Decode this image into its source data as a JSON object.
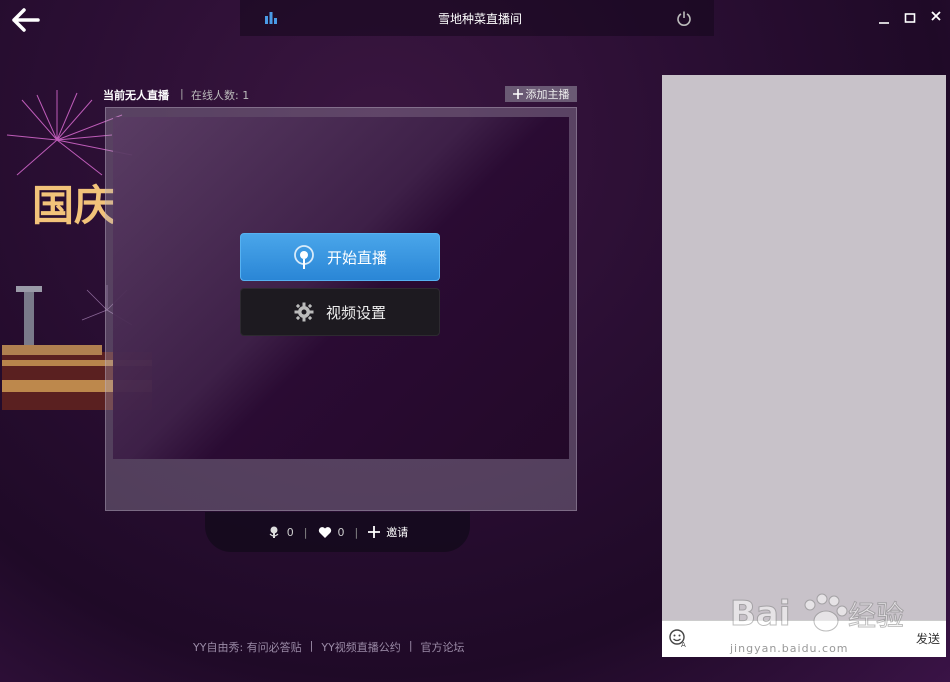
{
  "window": {
    "title": "雪地种菜直播间"
  },
  "live": {
    "status": "当前无人直播",
    "separator": "|",
    "online_text": "在线人数: 1",
    "add_host_label": "添加主播"
  },
  "video": {
    "start_live_label": "开始直播",
    "settings_label": "视频设置"
  },
  "stats": {
    "flower_count": "0",
    "heart_count": "0",
    "invite_label": "邀请",
    "sep": "|"
  },
  "footer": {
    "links": [
      "YY自由秀: 有问必答贴",
      "YY视频直播公约",
      "官方论坛"
    ],
    "sep": "|"
  },
  "chat": {
    "send_label": "发送"
  },
  "watermark": {
    "brand": "Bai",
    "brand_cn": "经验",
    "url": "jingyan.baidu.com"
  },
  "decor": {
    "banner_text": "国庆"
  },
  "colors": {
    "accent_blue": "#2a86d6",
    "chat_bg": "#c8c2c9"
  }
}
